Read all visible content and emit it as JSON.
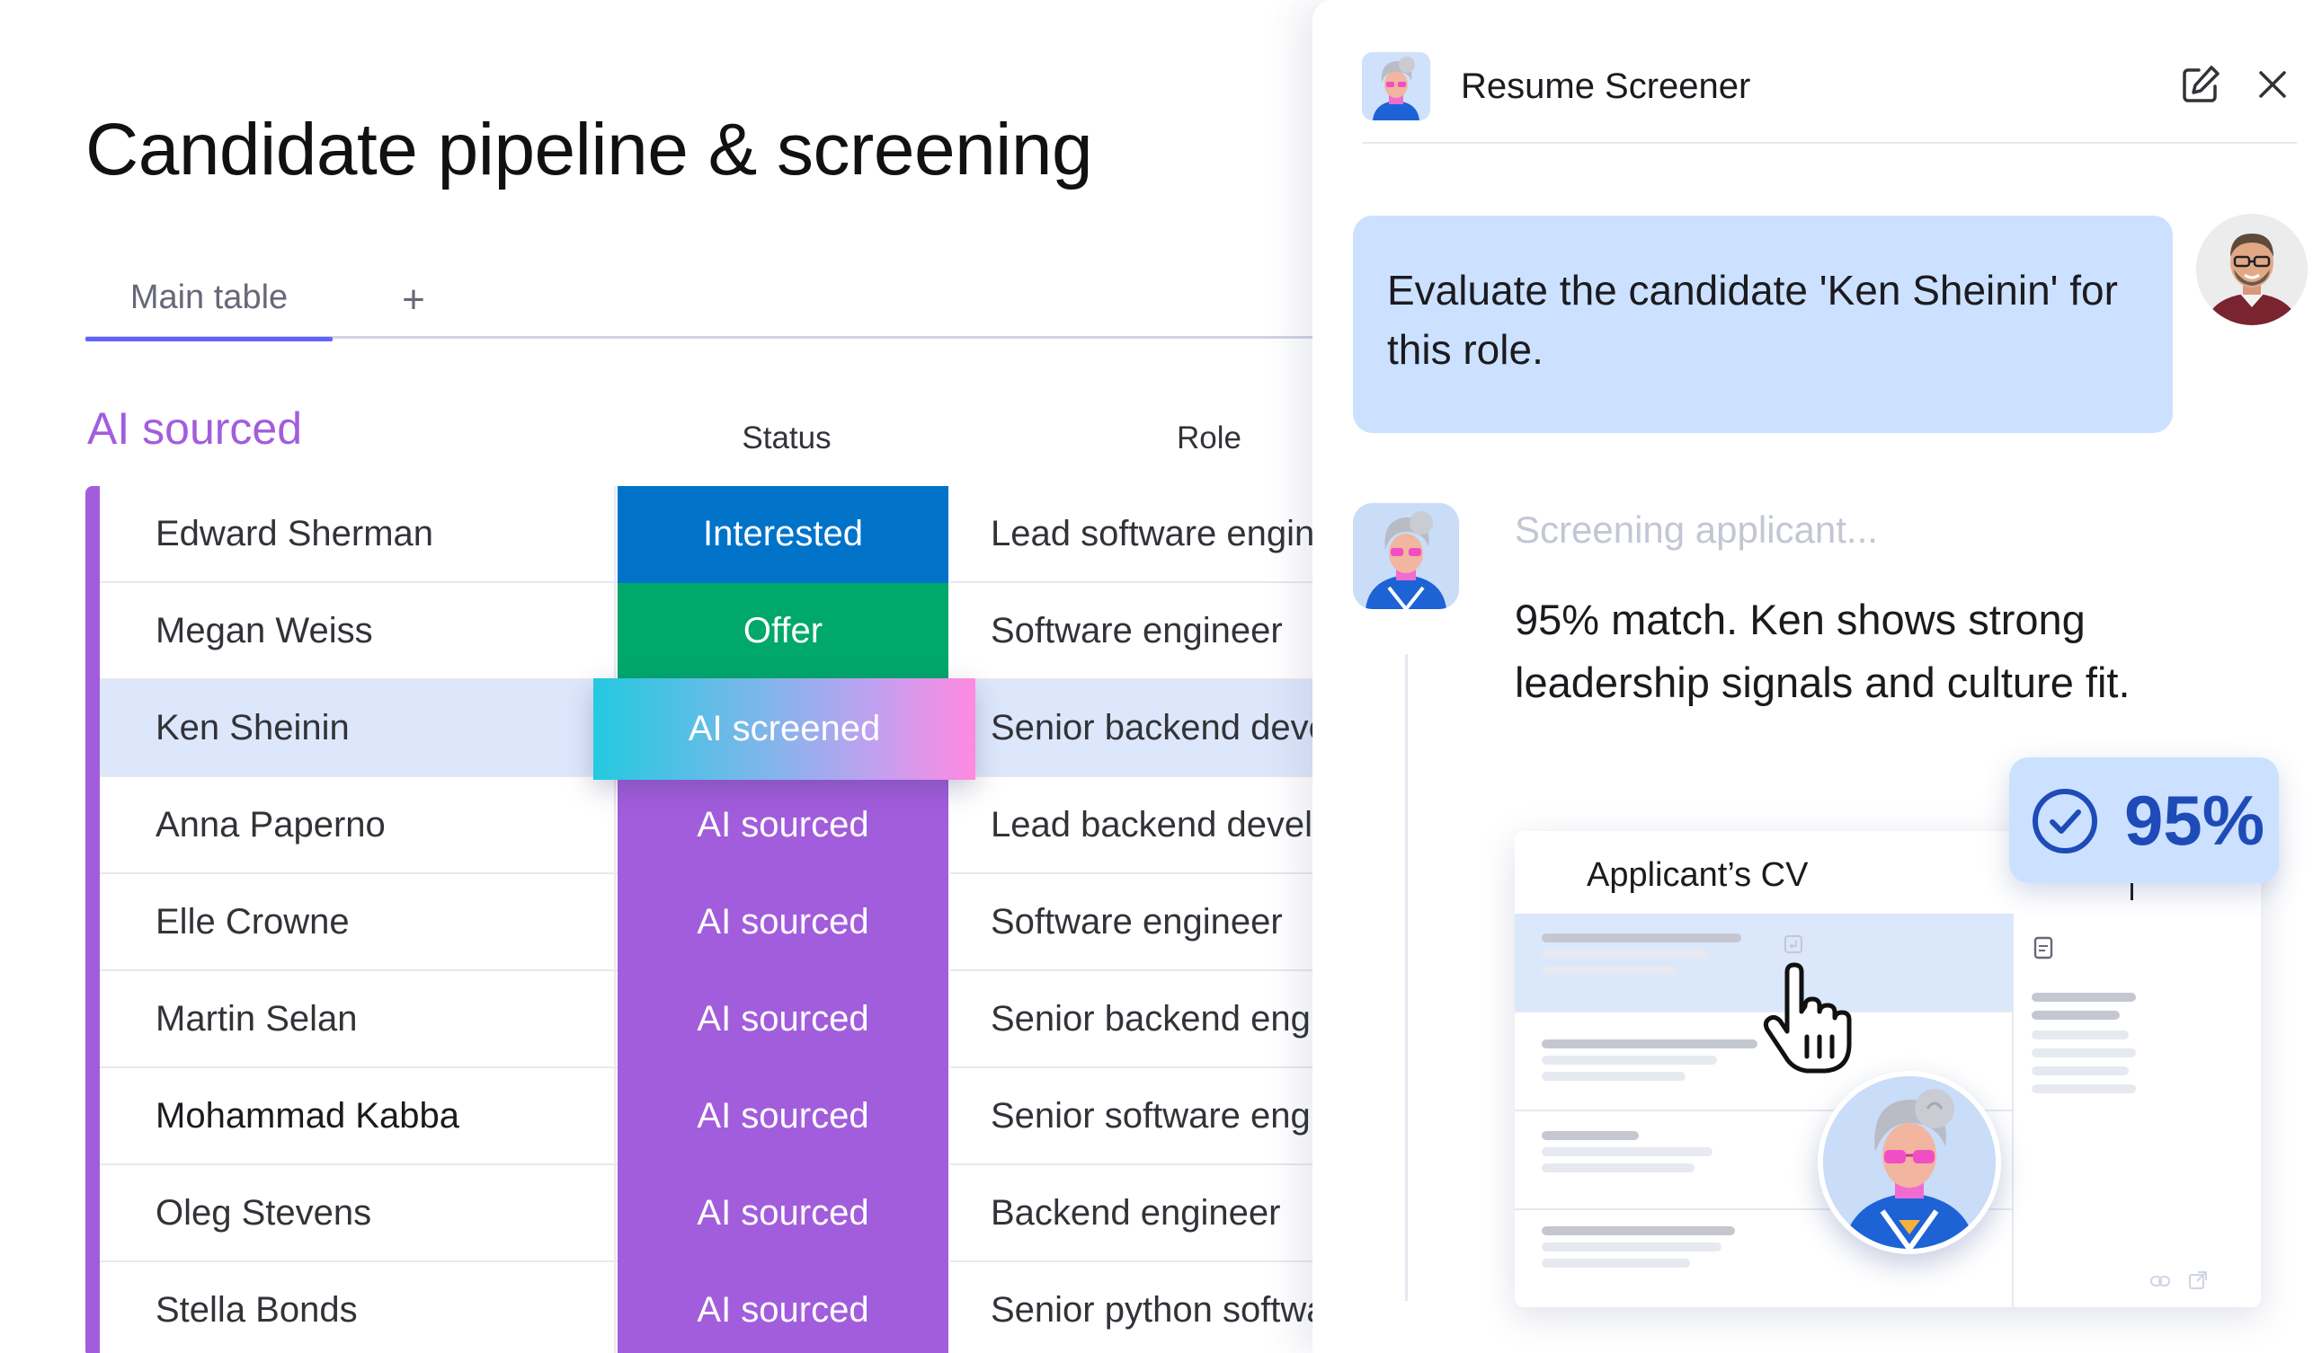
{
  "page": {
    "title": "Candidate pipeline & screening",
    "tabs": [
      {
        "label": "Main table",
        "active": true
      }
    ],
    "add_tab_label": "+"
  },
  "group": {
    "title": "AI sourced",
    "color": "#a25ddc",
    "columns": {
      "status": "Status",
      "role": "Role"
    }
  },
  "status_colors": {
    "Interested": "#0073c9",
    "Offer": "#00a86b",
    "AI sourced": "#a25ddc"
  },
  "rows": [
    {
      "name": "Edward Sherman",
      "status": "Interested",
      "role": "Lead software engineer"
    },
    {
      "name": "Megan Weiss",
      "status": "Offer",
      "role": "Software engineer"
    },
    {
      "name": "Ken Sheinin",
      "status": "AI screened",
      "role": "Senior backend developer",
      "selected": true
    },
    {
      "name": "Anna Paperno",
      "status": "AI sourced",
      "role": "Lead backend developer"
    },
    {
      "name": "Elle Crowne",
      "status": "AI sourced",
      "role": "Software engineer"
    },
    {
      "name": "Martin Selan",
      "status": "AI sourced",
      "role": "Senior backend engineer"
    },
    {
      "name": "Mohammad Kabba",
      "status": "AI sourced",
      "role": "Senior software engineer"
    },
    {
      "name": "Oleg Stevens",
      "status": "AI sourced",
      "role": "Backend engineer"
    },
    {
      "name": "Stella Bonds",
      "status": "AI sourced",
      "role": "Senior python software engineer"
    }
  ],
  "panel": {
    "title": "Resume Screener",
    "edit_icon": "edit-icon",
    "close_icon": "close-icon",
    "user_message": "Evaluate the candidate 'Ken Sheinin' for this role.",
    "status_text": "Screening applicant...",
    "answer": "95% match. Ken shows strong leadership signals and culture fit.",
    "cv_title": "Applicant’s CV",
    "match": "95%",
    "match_icon": "check-circle-icon",
    "accent": "#1f4bb8"
  }
}
